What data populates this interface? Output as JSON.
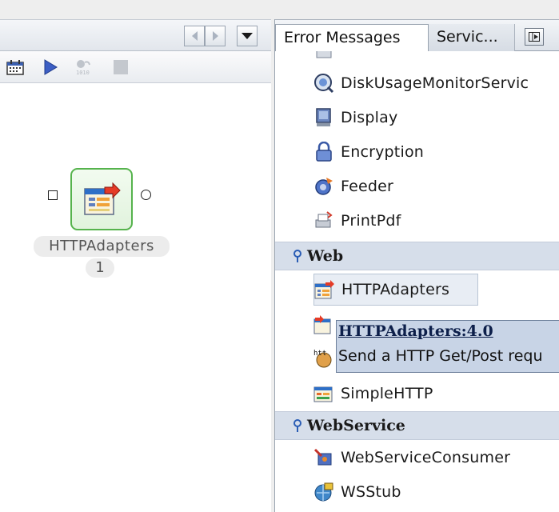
{
  "editor": {
    "toolbar_icons": [
      "calendar-icon",
      "play-icon",
      "debug-icon",
      "stop-icon"
    ],
    "component": {
      "label": "HTTPAdapters",
      "index": "1"
    }
  },
  "palette": {
    "tabs": [
      {
        "label": "Error Messages",
        "active": true
      },
      {
        "label": "Servic...",
        "active": false
      }
    ],
    "items_top": [
      {
        "label": "DiskUsageMonitorServic",
        "icon": "disk-monitor-icon"
      },
      {
        "label": "Display",
        "icon": "display-icon"
      },
      {
        "label": "Encryption",
        "icon": "lock-icon"
      },
      {
        "label": "Feeder",
        "icon": "feeder-icon"
      },
      {
        "label": "PrintPdf",
        "icon": "print-pdf-icon"
      }
    ],
    "category_web": "Web",
    "items_web": [
      {
        "label": "HTTPAdapters",
        "icon": "http-adapter-icon"
      },
      {
        "label": "SimpleHTTP",
        "icon": "simple-http-icon"
      }
    ],
    "category_webservice": "WebService",
    "items_webservice": [
      {
        "label": "WebServiceConsumer",
        "icon": "webservice-consumer-icon"
      },
      {
        "label": "WSStub",
        "icon": "wsstub-icon"
      }
    ],
    "tooltip": {
      "title": "HTTPAdapters:4.0",
      "description": "Send a HTTP Get/Post requ"
    }
  },
  "colors": {
    "selection_bg": "#e8edf4",
    "category_bg": "#d6deea",
    "tooltip_bg": "#c8d4e6",
    "component_border": "#56b34d"
  }
}
